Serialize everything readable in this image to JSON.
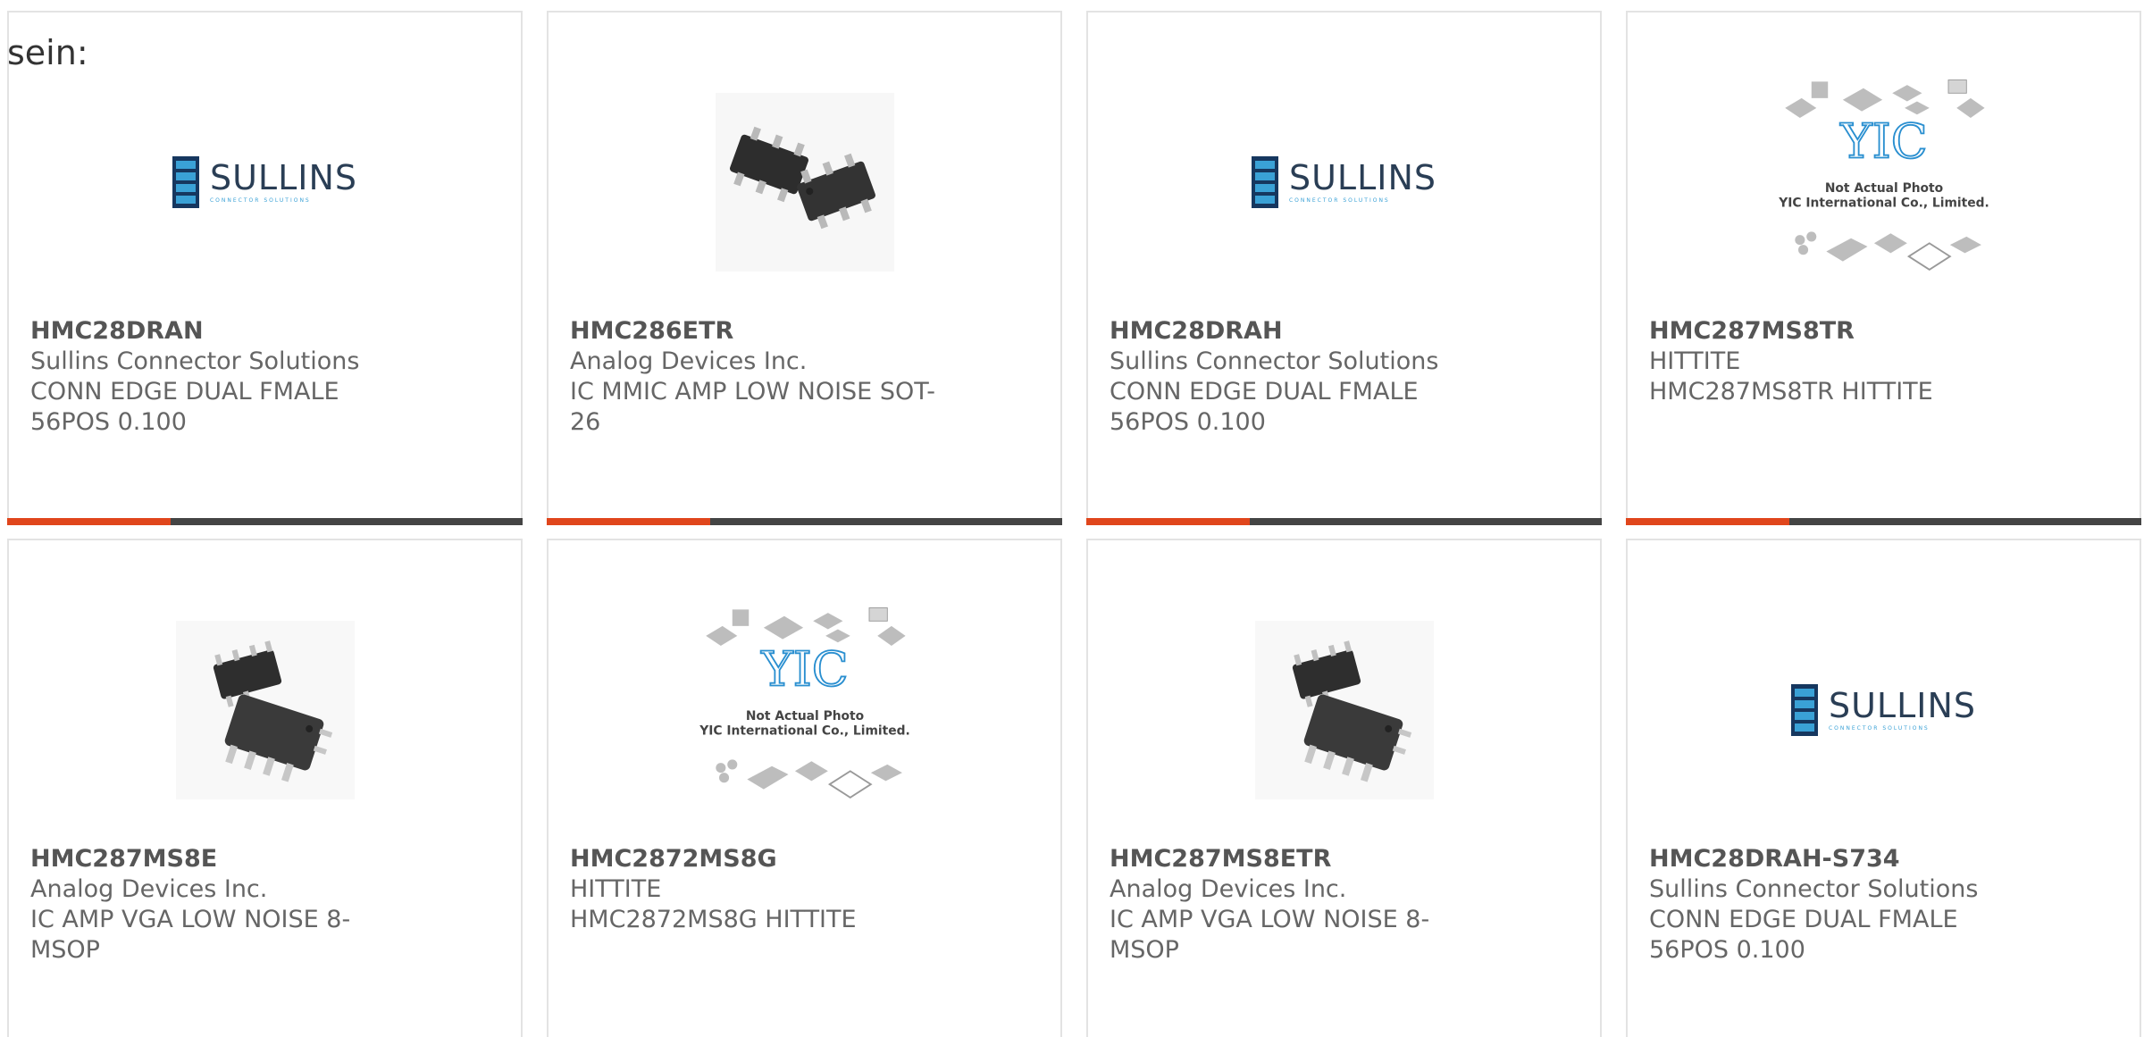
{
  "intro_text": "sein:",
  "products": [
    {
      "part": "HMC28DRAN",
      "manufacturer": "Sullins Connector Solutions",
      "description": "CONN EDGE DUAL FMALE 56POS 0.100",
      "image": "sullins-logo"
    },
    {
      "part": "HMC286ETR",
      "manufacturer": "Analog Devices Inc.",
      "description": "IC MMIC AMP LOW NOISE SOT-26",
      "image": "sot26-chip-photo"
    },
    {
      "part": "HMC28DRAH",
      "manufacturer": "Sullins Connector Solutions",
      "description": "CONN EDGE DUAL FMALE 56POS 0.100",
      "image": "sullins-logo"
    },
    {
      "part": "HMC287MS8TR",
      "manufacturer": "HITTITE",
      "description": "HMC287MS8TR HITTITE",
      "image": "yic-placeholder"
    },
    {
      "part": "HMC287MS8E",
      "manufacturer": "Analog Devices Inc.",
      "description": "IC AMP VGA LOW NOISE 8-MSOP",
      "image": "msop8-chip-photo"
    },
    {
      "part": "HMC2872MS8G",
      "manufacturer": "HITTITE",
      "description": "HMC2872MS8G HITTITE",
      "image": "yic-placeholder"
    },
    {
      "part": "HMC287MS8ETR",
      "manufacturer": "Analog Devices Inc.",
      "description": "IC AMP VGA LOW NOISE 8-MSOP",
      "image": "msop8-chip-photo"
    },
    {
      "part": "HMC28DRAH-S734",
      "manufacturer": "Sullins Connector Solutions",
      "description": "CONN EDGE DUAL FMALE 56POS 0.100",
      "image": "sullins-logo"
    }
  ],
  "logos": {
    "sullins_word": "SULLINS",
    "sullins_tagline": "CONNECTOR SOLUTIONS",
    "yic_mark": "YIC",
    "yic_caption_1": "Not Actual Photo",
    "yic_caption_2": "YIC International Co., Limited."
  },
  "colors": {
    "accent_orange": "#e0461c",
    "accent_dark": "#444444",
    "text_gray": "#666666",
    "card_border": "#e3e3e3"
  }
}
